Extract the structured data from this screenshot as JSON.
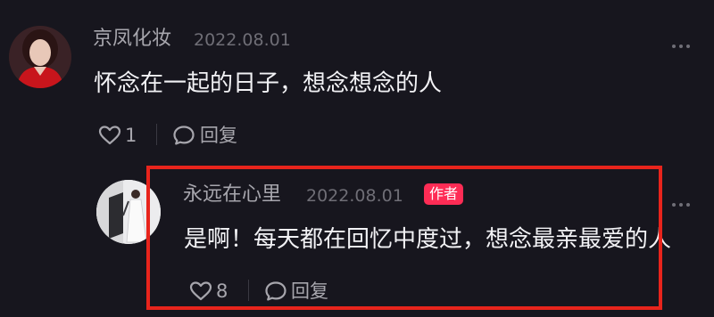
{
  "comments": [
    {
      "username": "京凤化妆",
      "date": "2022.08.01",
      "text": "怀念在一起的日子，想念想念的人",
      "likes": "1",
      "reply_label": "回复"
    },
    {
      "username": "永远在心里",
      "date": "2022.08.01",
      "badge": "作者",
      "text": "是啊！每天都在回忆中度过，想念最亲最爱的人",
      "likes": "8",
      "reply_label": "回复"
    }
  ],
  "colors": {
    "background": "#17161e",
    "username": "#a7a6ad",
    "date": "#6f6e76",
    "body": "#f2f2f5",
    "badge": "#fe2c55",
    "highlight": "#e8241c"
  }
}
